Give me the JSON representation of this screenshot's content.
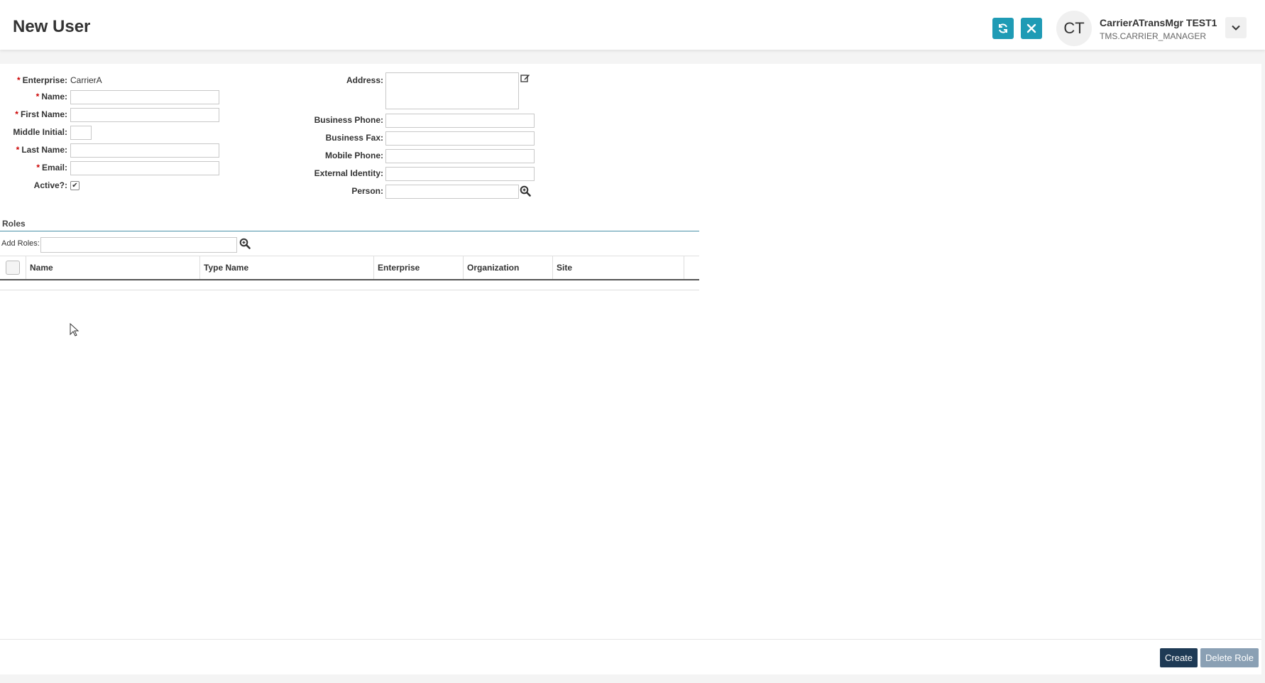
{
  "header": {
    "title": "New User",
    "refresh_icon": "refresh-icon",
    "close_icon": "close-icon",
    "user": {
      "initials": "CT",
      "name": "CarrierATransMgr TEST1",
      "role": "TMS.CARRIER_MANAGER"
    },
    "menu_icon": "chevron-down-icon"
  },
  "form": {
    "left": {
      "enterprise_label": "Enterprise:",
      "enterprise_value": "CarrierA",
      "name_label": "Name:",
      "name_value": "",
      "first_name_label": "First Name:",
      "first_name_value": "",
      "middle_initial_label": "Middle Initial:",
      "middle_initial_value": "",
      "last_name_label": "Last Name:",
      "last_name_value": "",
      "email_label": "Email:",
      "email_value": "",
      "active_label": "Active?:",
      "active_checked": true
    },
    "right": {
      "address_label": "Address:",
      "address_value": "",
      "business_phone_label": "Business Phone:",
      "business_phone_value": "",
      "business_fax_label": "Business Fax:",
      "business_fax_value": "",
      "mobile_phone_label": "Mobile Phone:",
      "mobile_phone_value": "",
      "external_identity_label": "External Identity:",
      "external_identity_value": "",
      "person_label": "Person:",
      "person_value": ""
    }
  },
  "roles": {
    "section_title": "Roles",
    "add_roles_label": "Add Roles:",
    "add_roles_value": "",
    "columns": [
      "Name",
      "Type Name",
      "Enterprise",
      "Organization",
      "Site"
    ],
    "rows": []
  },
  "footer": {
    "create_label": "Create",
    "delete_role_label": "Delete Role"
  },
  "colors": {
    "accent": "#1f9bb5",
    "primary_button": "#1e3a55",
    "disabled_button": "#8aa0b4",
    "required": "#cc0000"
  }
}
